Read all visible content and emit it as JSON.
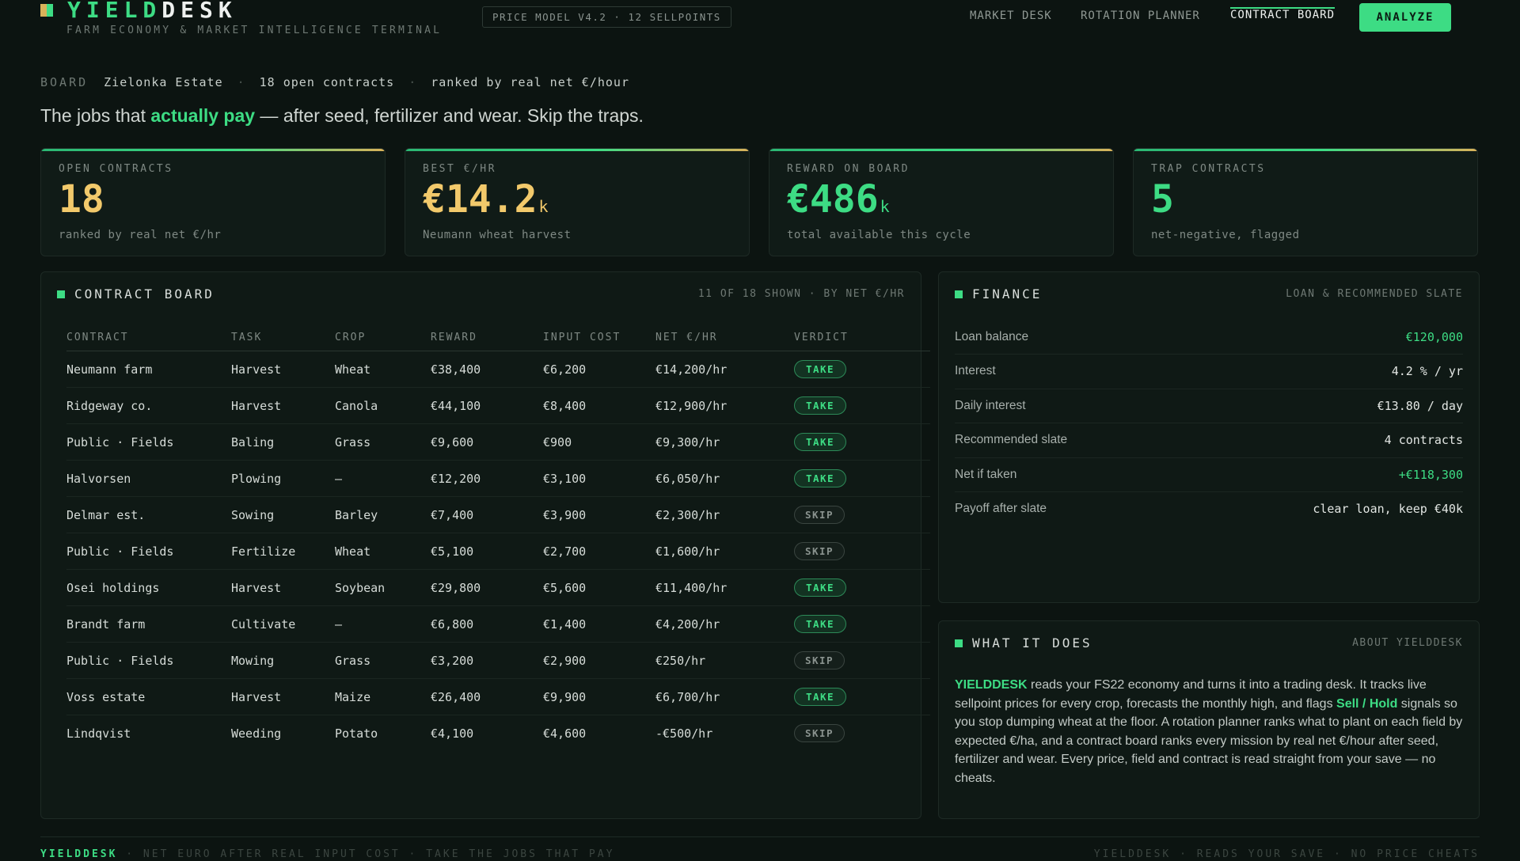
{
  "brand": {
    "name_part1": "YIELD",
    "name_part2": "DESK",
    "tagline": "FARM ECONOMY & MARKET INTELLIGENCE TERMINAL",
    "mark_colors": [
      "#d9b25a",
      "#3ddc84"
    ]
  },
  "model_chip": "PRICE MODEL V4.2 · 12 SELLPOINTS",
  "nav": {
    "items": [
      {
        "label": "MARKET DESK",
        "active": false
      },
      {
        "label": "ROTATION PLANNER",
        "active": false
      },
      {
        "label": "CONTRACT BOARD",
        "active": true
      }
    ],
    "cta": "ANALYZE"
  },
  "crumb": {
    "key": "BOARD",
    "farm": "Zielonka Estate",
    "count": "18 open contracts",
    "rank": "ranked by real net €/hour"
  },
  "headline": {
    "pre": "The jobs that ",
    "highlight": "actually pay",
    "post": " — after seed, fertilizer and wear. Skip the traps."
  },
  "kpis": [
    {
      "label": "OPEN CONTRACTS",
      "value": "18",
      "unit": "",
      "sub": "ranked by real net €/hr",
      "color": "#f2c96b"
    },
    {
      "label": "BEST €/HR",
      "value": "€14.2",
      "unit": "k",
      "sub": "Neumann wheat harvest",
      "color": "#f2c96b"
    },
    {
      "label": "REWARD ON BOARD",
      "value": "€486",
      "unit": "k",
      "sub": "total available this cycle",
      "color": "#3ddc84"
    },
    {
      "label": "TRAP CONTRACTS",
      "value": "5",
      "unit": "",
      "sub": "net-negative, flagged",
      "color": "#3ddc84"
    }
  ],
  "board": {
    "title": "CONTRACT BOARD",
    "meta": "11 OF 18 SHOWN · BY NET €/HR",
    "columns": [
      "CONTRACT",
      "TASK",
      "CROP",
      "REWARD",
      "INPUT COST",
      "NET €/HR",
      "VERDICT"
    ],
    "rows": [
      {
        "contract": "Neumann farm",
        "task": "Harvest",
        "crop": "Wheat",
        "reward": "€38,400",
        "input": "€6,200",
        "net": "€14,200/hr",
        "verdict": "TAKE"
      },
      {
        "contract": "Ridgeway co.",
        "task": "Harvest",
        "crop": "Canola",
        "reward": "€44,100",
        "input": "€8,400",
        "net": "€12,900/hr",
        "verdict": "TAKE"
      },
      {
        "contract": "Public · Fields",
        "task": "Baling",
        "crop": "Grass",
        "reward": "€9,600",
        "input": "€900",
        "net": "€9,300/hr",
        "verdict": "TAKE"
      },
      {
        "contract": "Halvorsen",
        "task": "Plowing",
        "crop": "—",
        "reward": "€12,200",
        "input": "€3,100",
        "net": "€6,050/hr",
        "verdict": "TAKE"
      },
      {
        "contract": "Delmar est.",
        "task": "Sowing",
        "crop": "Barley",
        "reward": "€7,400",
        "input": "€3,900",
        "net": "€2,300/hr",
        "verdict": "SKIP"
      },
      {
        "contract": "Public · Fields",
        "task": "Fertilize",
        "crop": "Wheat",
        "reward": "€5,100",
        "input": "€2,700",
        "net": "€1,600/hr",
        "verdict": "SKIP"
      },
      {
        "contract": "Osei holdings",
        "task": "Harvest",
        "crop": "Soybean",
        "reward": "€29,800",
        "input": "€5,600",
        "net": "€11,400/hr",
        "verdict": "TAKE"
      },
      {
        "contract": "Brandt farm",
        "task": "Cultivate",
        "crop": "—",
        "reward": "€6,800",
        "input": "€1,400",
        "net": "€4,200/hr",
        "verdict": "TAKE"
      },
      {
        "contract": "Public · Fields",
        "task": "Mowing",
        "crop": "Grass",
        "reward": "€3,200",
        "input": "€2,900",
        "net": "€250/hr",
        "verdict": "SKIP"
      },
      {
        "contract": "Voss estate",
        "task": "Harvest",
        "crop": "Maize",
        "reward": "€26,400",
        "input": "€9,900",
        "net": "€6,700/hr",
        "verdict": "TAKE"
      },
      {
        "contract": "Lindqvist",
        "task": "Weeding",
        "crop": "Potato",
        "reward": "€4,100",
        "input": "€4,600",
        "net": "-€500/hr",
        "verdict": "SKIP"
      }
    ]
  },
  "finance": {
    "title": "FINANCE",
    "meta": "LOAN & RECOMMENDED SLATE",
    "rows": [
      {
        "label": "Loan balance",
        "value": "€120,000",
        "green": true
      },
      {
        "label": "Interest",
        "value": "4.2 % / yr",
        "green": false
      },
      {
        "label": "Daily interest",
        "value": "€13.80 / day",
        "green": false
      },
      {
        "label": "Recommended slate",
        "value": "4 contracts",
        "green": false
      },
      {
        "label": "Net if taken",
        "value": "+€118,300",
        "green": true
      },
      {
        "label": "Payoff after slate",
        "value": "clear loan, keep €40k",
        "green": false
      }
    ]
  },
  "about": {
    "title": "WHAT IT DOES",
    "meta": "ABOUT YIELDDESK",
    "brand": "YIELDDESK",
    "text1": " reads your FS22 economy and turns it into a trading desk. It tracks live sellpoint prices for every crop, forecasts the monthly high, and flags ",
    "signal": "Sell / Hold",
    "text2": " signals so you stop dumping wheat at the floor. A rotation planner ranks what to plant on each field by expected €/ha, and a contract board ranks every mission by real net €/hour after seed, fertilizer and wear. Every price, field and contract is read straight from your save — no cheats."
  },
  "footer": {
    "brand": "YIELDDESK",
    "left": " · NET EURO AFTER REAL INPUT COST · TAKE THE JOBS THAT PAY",
    "right": "YIELDDESK · READS YOUR SAVE · NO PRICE CHEATS"
  }
}
